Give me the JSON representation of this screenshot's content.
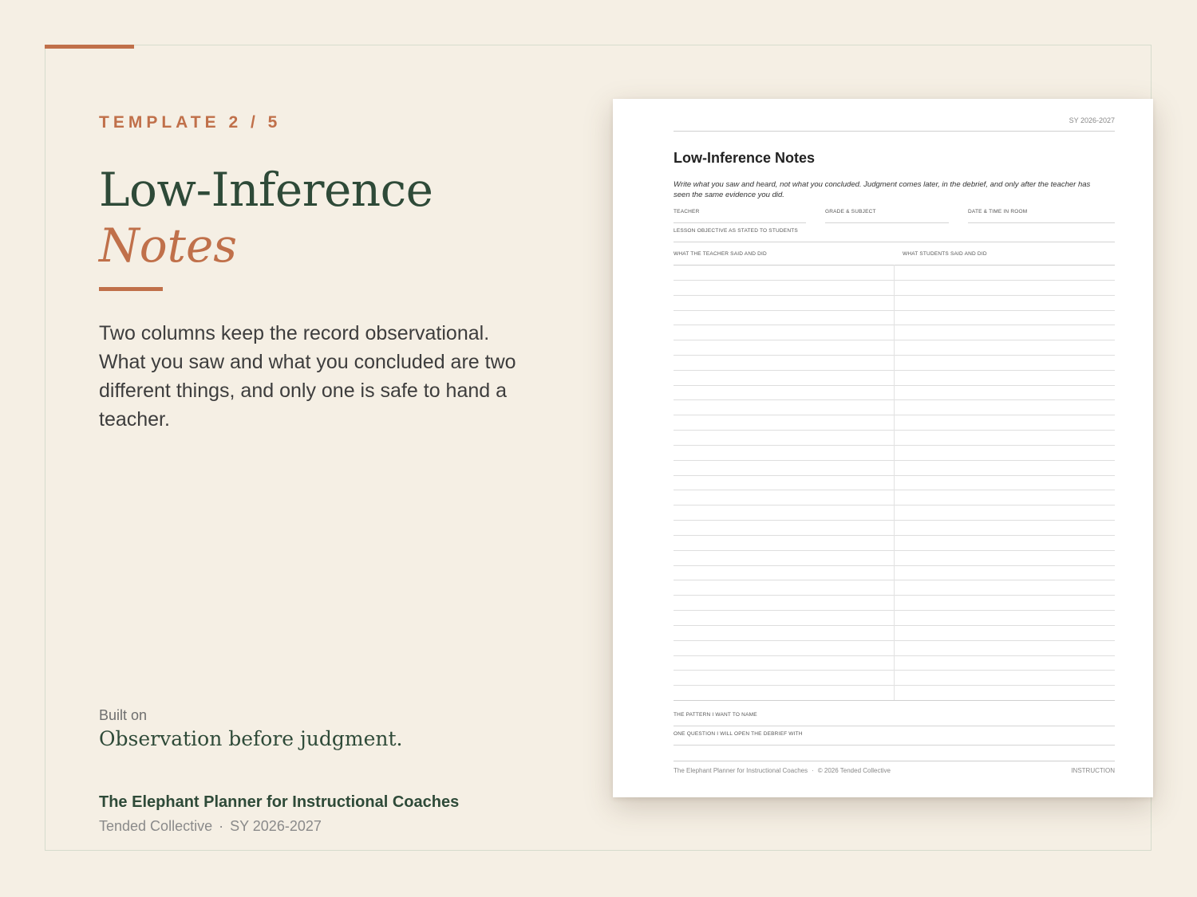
{
  "eyebrow": "TEMPLATE 2 / 5",
  "title_line1": "Low-Inference",
  "title_line2": "Notes",
  "description": "Two columns keep the record observational. What you saw and what you concluded are two different things, and only one is safe to hand a teacher.",
  "built_on": {
    "label": "Built on",
    "value": "Observation before judgment."
  },
  "product": {
    "name": "The Elephant Planner for Instructional Coaches",
    "publisher": "Tended Collective",
    "separator": "·",
    "school_year": "SY 2026-2027"
  },
  "document": {
    "school_year": "SY 2026-2027",
    "title": "Low-Inference Notes",
    "intro": "Write what you saw and heard, not what you concluded. Judgment comes later, in the debrief, and only after the teacher has seen the same evidence you did.",
    "fields": {
      "teacher": "TEACHER",
      "grade_subject": "GRADE & SUBJECT",
      "date_time": "DATE & TIME IN ROOM",
      "objective": "LESSON OBJECTIVE AS STATED TO STUDENTS"
    },
    "columns": {
      "left": "WHAT THE TEACHER SAID AND DID",
      "right": "WHAT STUDENTS SAID AND DID"
    },
    "note_rows": 29,
    "closing_fields": {
      "pattern": "THE PATTERN I WANT TO NAME",
      "question": "ONE QUESTION I WILL OPEN THE DEBRIEF WITH"
    },
    "footer": {
      "left_title": "The Elephant Planner for Instructional Coaches",
      "separator": "·",
      "copyright": "© 2026 Tended Collective",
      "section": "INSTRUCTION"
    }
  },
  "colors": {
    "background": "#f5efe4",
    "accent": "#c0704a",
    "heading_green": "#2e4a38"
  }
}
